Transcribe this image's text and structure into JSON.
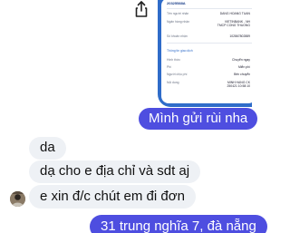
{
  "receipt": {
    "code": "20325588A",
    "rows": [
      {
        "label": "Tên người nhận",
        "value": "DANG HOANG TUAN"
      },
      {
        "label": "Ngân hàng nhận",
        "value": "VIETINBANK - NH TMCP CONG THUONG"
      },
      {
        "label": "Số khoản nhận",
        "value": "102867802889"
      }
    ],
    "section_title": "Thông tin giao dịch",
    "detail_rows": [
      {
        "label": "Hình thức",
        "value": "Chuyển ngay"
      },
      {
        "label": "Phí",
        "value": "Miễn phí"
      },
      {
        "label": "Người chịu phí",
        "value": "Bên chuyển"
      },
      {
        "label": "Nội dung",
        "value": "MINH HANG CK 250421 10:58:10"
      }
    ]
  },
  "messages": [
    {
      "from": "me",
      "text": "Mình gửi rùi nha"
    },
    {
      "from": "them",
      "text": "da"
    },
    {
      "from": "them",
      "text": "dạ cho e địa chỉ và sdt aj"
    },
    {
      "from": "them",
      "text": "e xin đ/c chút em đi đơn"
    },
    {
      "from": "me",
      "text": "31 trung nghĩa 7, đà nẵng"
    }
  ],
  "colors": {
    "outgoing": "#4e4ee0",
    "incoming": "#eef1f5",
    "receipt_frame": "#2f6cc9"
  },
  "icons": {
    "share": "share-icon",
    "avatar": "contact-avatar"
  }
}
